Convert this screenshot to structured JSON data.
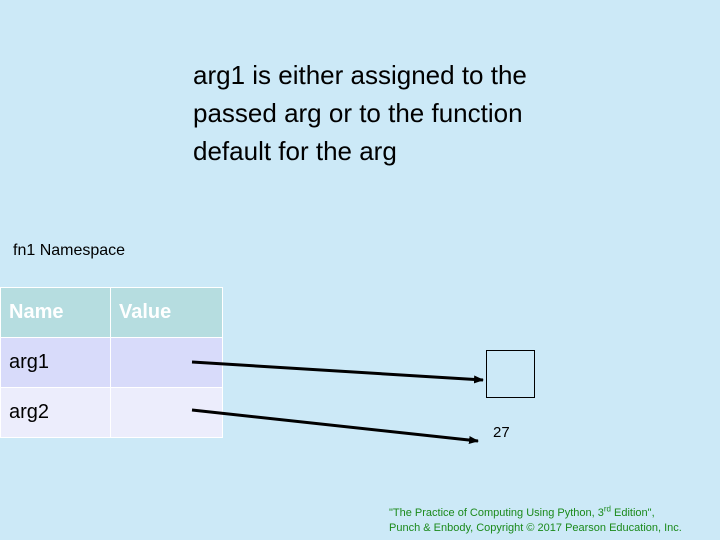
{
  "caption": {
    "line1": "arg1 is either assigned to the",
    "line2": "passed arg or to the function",
    "line3": "default for the arg"
  },
  "namespace": {
    "title": "fn1 Namespace",
    "headers": [
      "Name",
      "Value"
    ],
    "rows": [
      {
        "name": "arg1",
        "value": ""
      },
      {
        "name": "arg2",
        "value": ""
      }
    ]
  },
  "objects": {
    "default_value": "27"
  },
  "credit": {
    "text_a": "\"The Practice of Computing Using Python, 3",
    "sup": "rd",
    "text_b": " Edition\",",
    "line2": "Punch & Enbody, Copyright © 2017 Pearson Education, Inc."
  },
  "colors": {
    "background": "#cce9f7",
    "header_fill": "#b6dde0",
    "row1_fill": "#d8dbfa",
    "row2_fill": "#ecedfc",
    "credit_text": "#1b8a1b"
  }
}
